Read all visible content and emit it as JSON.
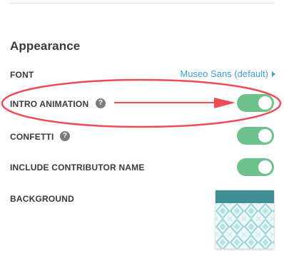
{
  "appearance": {
    "section_title": "Appearance",
    "font": {
      "label": "FONT",
      "value": "Museo Sans (default)"
    },
    "intro_animation": {
      "label": "INTRO ANIMATION",
      "help": "?",
      "enabled": true
    },
    "confetti": {
      "label": "CONFETTI",
      "help": "?",
      "enabled": true
    },
    "include_contributor_name": {
      "label": "INCLUDE CONTRIBUTOR NAME",
      "enabled": true
    },
    "background": {
      "label": "BACKGROUND"
    }
  },
  "colors": {
    "toggle_on": "#6cc28a",
    "link": "#3aa0db",
    "annotation": "#ef4b55",
    "swatch_header": "#3f8f95",
    "swatch_pattern": "#9fd6dc"
  },
  "icons": {
    "help": "question-circle-icon",
    "font_caret": "caret-right-icon"
  }
}
